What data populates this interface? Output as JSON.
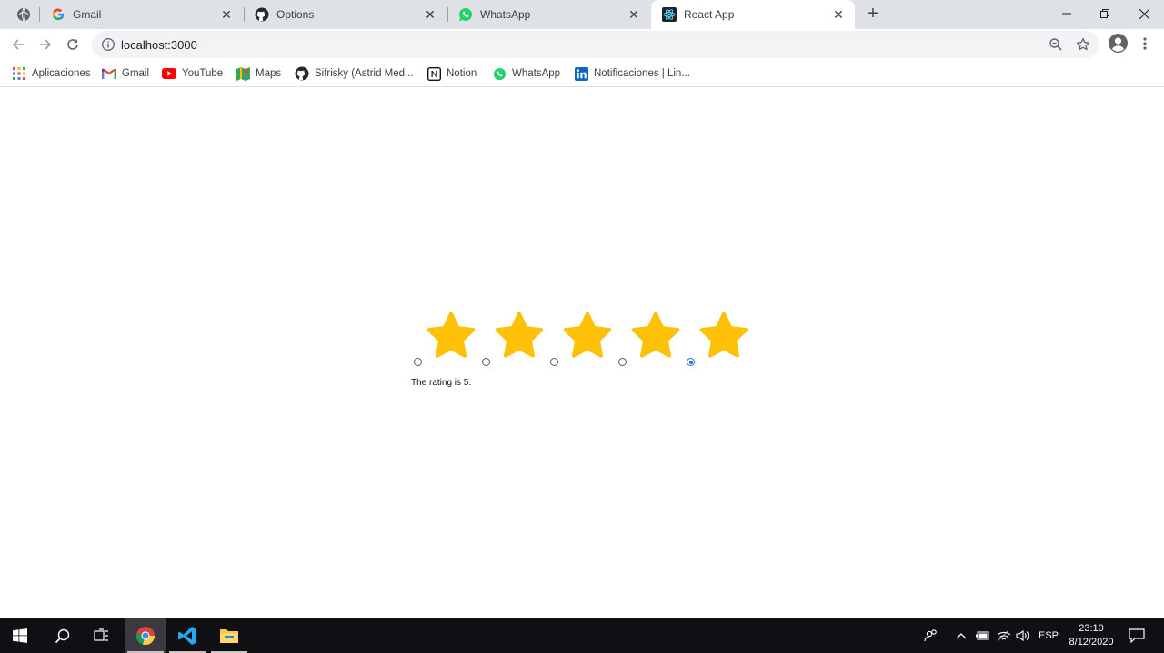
{
  "window": {
    "tabs": [
      {
        "title": "",
        "icon": "globe-icon"
      },
      {
        "title": "Gmail",
        "icon": "google-icon"
      },
      {
        "title": "Options",
        "icon": "github-icon"
      },
      {
        "title": "WhatsApp",
        "icon": "whatsapp-icon"
      },
      {
        "title": "React App",
        "icon": "react-icon",
        "active": true
      }
    ],
    "new_tab_glyph": "+"
  },
  "toolbar": {
    "url": "localhost:3000"
  },
  "bookmarks": [
    {
      "label": "Aplicaciones",
      "icon": "apps-grid-icon"
    },
    {
      "label": "Gmail",
      "icon": "gmail-icon"
    },
    {
      "label": "YouTube",
      "icon": "youtube-icon"
    },
    {
      "label": "Maps",
      "icon": "maps-icon"
    },
    {
      "label": "Sifrisky (Astrid Med...",
      "icon": "github-icon"
    },
    {
      "label": "Notion",
      "icon": "notion-icon"
    },
    {
      "label": "WhatsApp",
      "icon": "whatsapp-icon"
    },
    {
      "label": "Notificaciones | Lin...",
      "icon": "linkedin-icon"
    }
  ],
  "app": {
    "rating": {
      "value": 5,
      "max": 5,
      "star_color": "#ffc107",
      "text": "The rating is 5."
    }
  },
  "taskbar": {
    "language": "ESP",
    "time": "23:10",
    "date": "8/12/2020"
  },
  "colors": {
    "tabstrip": "#dee1e6",
    "accent": "#1a73e8",
    "taskbar": "#0f0f14"
  }
}
